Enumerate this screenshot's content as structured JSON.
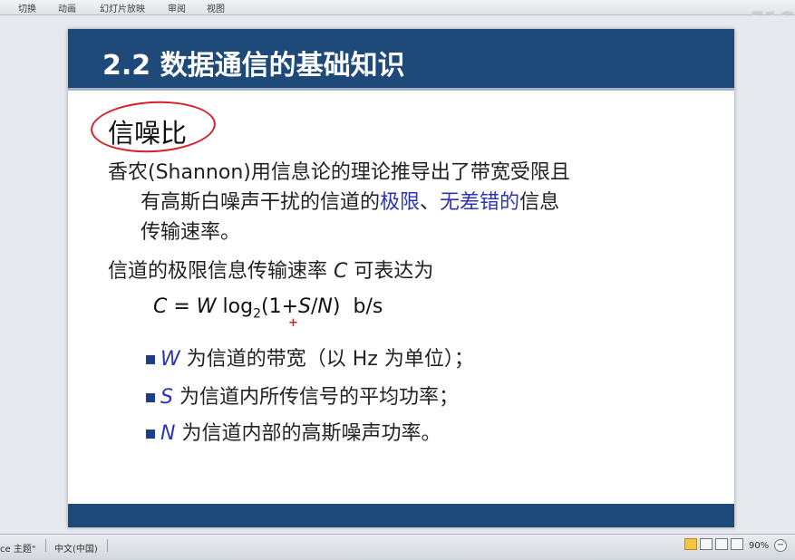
{
  "ribbon": {
    "tabs": [
      "切换",
      "动画",
      "幻灯片放映",
      "审阅",
      "视图"
    ]
  },
  "watermark": "51C",
  "slide": {
    "title": "2.2 数据通信的基础知识",
    "heading": "信噪比",
    "para1": {
      "line1": "香农(Shannon)用信息论的理论推导出了带宽受限且",
      "line2_a": "有高斯白噪声干扰的信道的",
      "line2_hl1": "极限",
      "line2_b": "、",
      "line2_hl2": "无差错的",
      "line2_c": "信息",
      "line3": "传输速率。"
    },
    "para2": {
      "a": "信道的极限信息传输速率 ",
      "var": "C",
      "b": " 可表达为"
    },
    "formula": {
      "c": "C",
      "eq": " = ",
      "w": "W",
      "log": " log",
      "sub": "2",
      "open": "(1+",
      "s": "S",
      "slash": "/",
      "n": "N",
      "close": ")",
      "unit": "b/s"
    },
    "bullets": [
      {
        "var": "W",
        "text": " 为信道的带宽（以 Hz 为单位）；"
      },
      {
        "var": "S",
        "text": " 为信道内所传信号的平均功率；"
      },
      {
        "var": "N",
        "text": " 为信道内部的高斯噪声功率。"
      }
    ]
  },
  "statusbar": {
    "theme": "ce 主题\"",
    "language": "中文(中国)",
    "zoom": "90%"
  },
  "colors": {
    "title_bar": "#1d4a78",
    "highlight": "#2b34b8",
    "annotation_red": "#d8202a"
  }
}
